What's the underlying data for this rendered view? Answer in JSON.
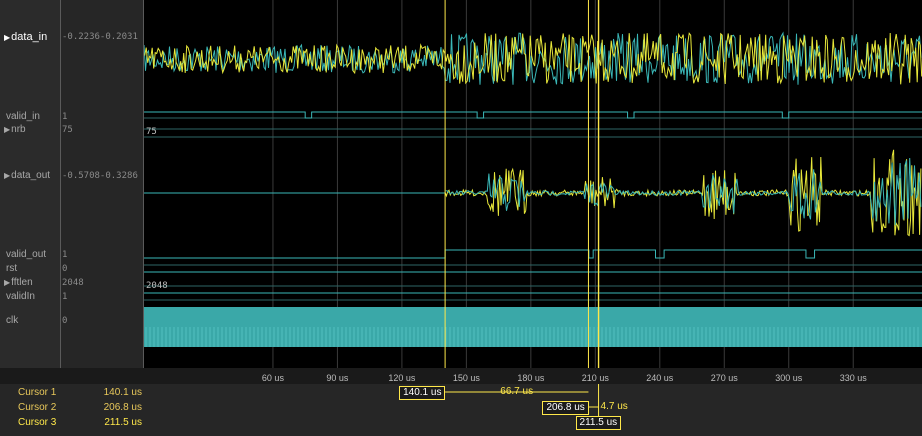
{
  "signals": [
    {
      "name": "data_in",
      "value": "-0.2236-0.2031",
      "selected": true,
      "bus": true
    },
    {
      "name": "valid_in",
      "value": "1"
    },
    {
      "name": "nrb",
      "value": "75",
      "bus": true
    },
    {
      "name": "data_out",
      "value": "-0.5708-0.3286",
      "bus": true
    },
    {
      "name": "valid_out",
      "value": "1"
    },
    {
      "name": "rst",
      "value": "0"
    },
    {
      "name": "fftlen",
      "value": "2048",
      "bus": true
    },
    {
      "name": "validIn",
      "value": "1"
    },
    {
      "name": "clk",
      "value": "0"
    }
  ],
  "bus_labels": {
    "nrb": "75",
    "fftlen": "2048"
  },
  "axis": {
    "unit": "us",
    "start": 0,
    "end": 362,
    "ticks": [
      "60 us",
      "90 us",
      "120 us",
      "150 us",
      "180 us",
      "210 us",
      "240 us",
      "270 us",
      "300 us",
      "330 us"
    ]
  },
  "cursors": [
    {
      "name": "Cursor 1",
      "value": "140.1 us",
      "time": 140.1,
      "flag": "140.1 us"
    },
    {
      "name": "Cursor 2",
      "value": "206.8 us",
      "time": 206.8,
      "flag": "206.8 us"
    },
    {
      "name": "Cursor 3",
      "value": "211.5 us",
      "time": 211.5,
      "flag": "211.5 us",
      "active": true
    }
  ],
  "deltas": {
    "c1_c2": "66.7 us",
    "c2_c3": "4.7 us"
  },
  "colors": {
    "trace_yellow": "#e8e83a",
    "trace_cyan": "#3ab7b7",
    "cursor": "#ffe84a",
    "grid": "#3a3a3a",
    "clk": "#3aa8a8"
  }
}
